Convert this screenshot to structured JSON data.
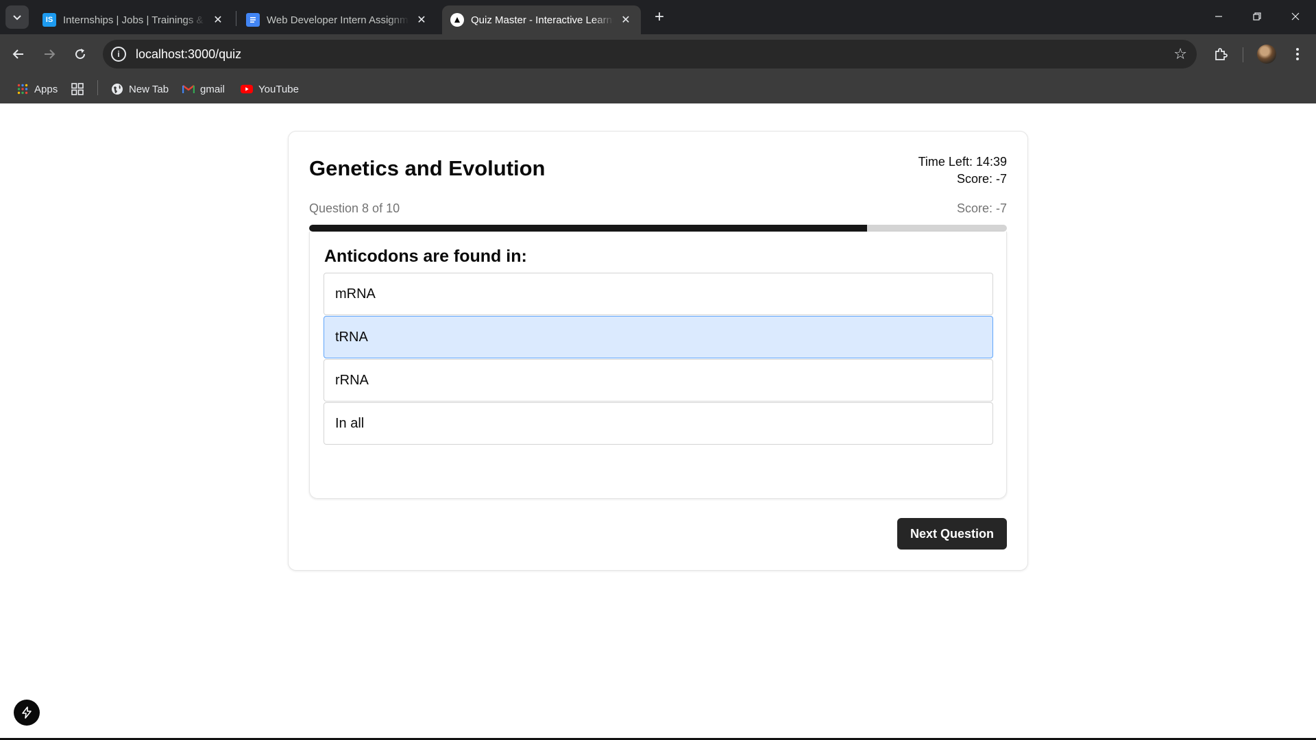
{
  "browser": {
    "tabs": [
      {
        "title": "Internships | Jobs | Trainings & Placement",
        "favicon_text": "IS",
        "favicon_color": "#1d9bf0",
        "active": false
      },
      {
        "title": "Web Developer Intern Assignment",
        "favicon_text": "",
        "favicon_color": "#4285f4",
        "active": false
      },
      {
        "title": "Quiz Master - Interactive Learning",
        "favicon_text": "",
        "favicon_color": "#ffffff",
        "active": true
      }
    ],
    "url": "localhost:3000/quiz",
    "bookmarks": [
      {
        "label": "Apps"
      },
      {
        "label": "New Tab"
      },
      {
        "label": "gmail"
      },
      {
        "label": "YouTube"
      }
    ]
  },
  "quiz": {
    "title": "Genetics and Evolution",
    "time_left": "Time Left: 14:39",
    "score_header": "Score: -7",
    "progress_label": "Question 8 of 10",
    "progress_score": "Score: -7",
    "progress_fraction": 0.8,
    "question": "Anticodons are found in:",
    "options": [
      {
        "label": "mRNA",
        "selected": false
      },
      {
        "label": "tRNA",
        "selected": true
      },
      {
        "label": "rRNA",
        "selected": false
      },
      {
        "label": "In all",
        "selected": false
      }
    ],
    "next_label": "Next Question"
  },
  "colors": {
    "selected_option_bg": "#dbeafe",
    "selected_option_border": "#60a5fa",
    "progress_fill": "#171717",
    "button_bg": "#262626"
  }
}
